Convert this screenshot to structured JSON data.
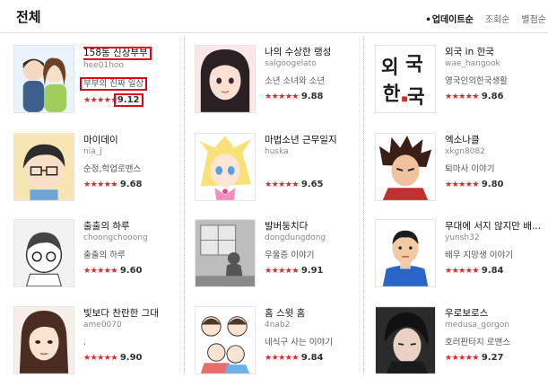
{
  "page_title": "전체",
  "sort_options": [
    {
      "label": "업데이트순",
      "active": true
    },
    {
      "label": "조회순",
      "active": false
    },
    {
      "label": "별점순",
      "active": false
    }
  ],
  "webtoons": [
    {
      "title": "158동 신상부부",
      "author": "hee01hoo",
      "genre": "부부의 진짜 일상",
      "stars": "★★★★★",
      "rating": "9.12",
      "thumb_icon": "couple-thumbnail-icon"
    },
    {
      "title": "나의 수상한 랭성",
      "author": "salgoogelato",
      "genre": "소년 소녀와 소년",
      "stars": "★★★★★",
      "rating": "9.88",
      "thumb_icon": "girl-thumbnail-icon"
    },
    {
      "title": "외국 in 한국",
      "author": "wae_hangook",
      "genre": "영국인의한국생활",
      "stars": "★★★★★",
      "rating": "9.86",
      "thumb_icon": "hangul-logo-thumbnail-icon",
      "thumb_text": [
        "외",
        "국",
        "한",
        "국"
      ]
    },
    {
      "title": "마이데이",
      "author": "nia_j",
      "genre": "순정,학업로맨스",
      "stars": "★★★★★",
      "rating": "9.68",
      "thumb_icon": "glasses-boy-thumbnail-icon"
    },
    {
      "title": "마법소년 근무일지",
      "author": "huska",
      "genre": "",
      "stars": "★★★★★",
      "rating": "9.65",
      "thumb_icon": "blonde-girl-thumbnail-icon"
    },
    {
      "title": "엑소나클",
      "author": "xkgn8082",
      "genre": "퇴마사 이야기",
      "stars": "★★★★★",
      "rating": "9.80",
      "thumb_icon": "spiky-boy-thumbnail-icon"
    },
    {
      "title": "출출의 하루",
      "author": "choongchooong",
      "genre": "출출의 하루",
      "stars": "★★★★★",
      "rating": "9.60",
      "thumb_icon": "sketch-boy-thumbnail-icon"
    },
    {
      "title": "발버둥치다",
      "author": "dongdungdong",
      "genre": "우울증 이야기",
      "stars": "★★★★★",
      "rating": "9.91",
      "thumb_icon": "window-room-thumbnail-icon"
    },
    {
      "title": "무대에 서지 않지만 배...",
      "author": "yunsh32",
      "genre": "배우 지망생 이야기",
      "stars": "★★★★★",
      "rating": "9.84",
      "thumb_icon": "blue-shirt-man-thumbnail-icon"
    },
    {
      "title": "빛보다 찬란한 그대",
      "author": "ame0070",
      "genre": ".",
      "stars": "★★★★★",
      "rating": "9.90",
      "thumb_icon": "woman-thumbnail-icon"
    },
    {
      "title": "홈 스윗 홈",
      "author": "4nab2",
      "genre": "네식구 사는 이야기",
      "stars": "★★★★★",
      "rating": "9.84",
      "thumb_icon": "family-thumbnail-icon"
    },
    {
      "title": "우로보로스",
      "author": "medusa_gorgon",
      "genre": "호러판타지 로맨스",
      "stars": "★★★★★",
      "rating": "9.27",
      "thumb_icon": "dark-man-thumbnail-icon"
    }
  ]
}
